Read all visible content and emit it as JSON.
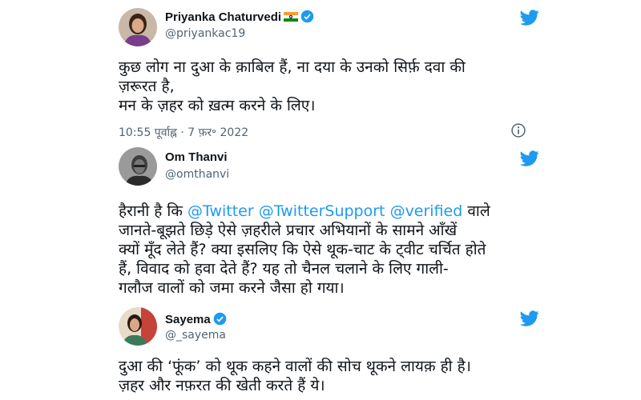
{
  "colors": {
    "accent": "#1d9bf0",
    "text": "#0f1419",
    "muted": "#536471"
  },
  "tweets": [
    {
      "name": "Priyanka Chaturvedi",
      "handle": "@priyankac19",
      "lines": [
        "कुछ लोग ना दुआ के क़ाबिल हैं, ना दया के उनको सिर्फ़ दवा की",
        "ज़रूरत है,",
        "मन के ज़हर को ख़त्म करने के लिए।"
      ],
      "timestamp": "10:55 पूर्वाह्न · 7 फ़र॰ 2022",
      "icons": [
        "india-flag-icon",
        "verified-badge-icon",
        "twitter-bird-icon",
        "info-icon"
      ]
    },
    {
      "name": "Om Thanvi",
      "handle": "@omthanvi",
      "first_line_pre": "हैरानी है कि",
      "mentions": [
        "@Twitter",
        "@TwitterSupport",
        "@verified"
      ],
      "first_line_post": "वाले",
      "lines": [
        "जानते-बूझते छिड़े ऐसे ज़हरीले प्रचार अभियानों के सामने आँखें",
        "क्यों मूँद लेते हैं? क्या इसलिए कि ऐसे थूक-चाट के ट्वीट चर्चित होते",
        "हैं, विवाद को हवा देते हैं? यह तो चैनल चलाने के लिए गाली-",
        "गलौज वालों को जमा करने जैसा हो गया।"
      ],
      "icons": [
        "verified-badge-icon",
        "twitter-bird-icon"
      ]
    },
    {
      "name": "Sayema",
      "handle": "@_sayema",
      "lines": [
        "दुआ की ‘फूंक’ को थूक कहने वालों की सोच थूकने लायक़ ही है।",
        "ज़हर और नफ़रत की खेती करते हैं ये।"
      ],
      "icons": [
        "verified-badge-icon",
        "twitter-bird-icon"
      ]
    }
  ]
}
